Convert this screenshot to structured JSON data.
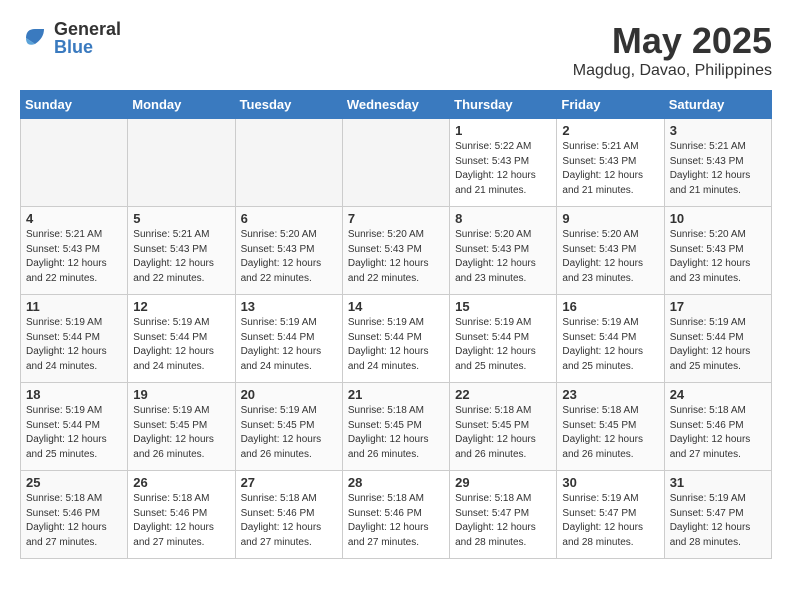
{
  "header": {
    "logo_general": "General",
    "logo_blue": "Blue",
    "month": "May 2025",
    "location": "Magdug, Davao, Philippines"
  },
  "days_of_week": [
    "Sunday",
    "Monday",
    "Tuesday",
    "Wednesday",
    "Thursday",
    "Friday",
    "Saturday"
  ],
  "weeks": [
    [
      {
        "day": "",
        "info": "",
        "empty": true
      },
      {
        "day": "",
        "info": "",
        "empty": true
      },
      {
        "day": "",
        "info": "",
        "empty": true
      },
      {
        "day": "",
        "info": "",
        "empty": true
      },
      {
        "day": "1",
        "info": "Sunrise: 5:22 AM\nSunset: 5:43 PM\nDaylight: 12 hours\nand 21 minutes.",
        "empty": false
      },
      {
        "day": "2",
        "info": "Sunrise: 5:21 AM\nSunset: 5:43 PM\nDaylight: 12 hours\nand 21 minutes.",
        "empty": false
      },
      {
        "day": "3",
        "info": "Sunrise: 5:21 AM\nSunset: 5:43 PM\nDaylight: 12 hours\nand 21 minutes.",
        "empty": false
      }
    ],
    [
      {
        "day": "4",
        "info": "Sunrise: 5:21 AM\nSunset: 5:43 PM\nDaylight: 12 hours\nand 22 minutes.",
        "empty": false
      },
      {
        "day": "5",
        "info": "Sunrise: 5:21 AM\nSunset: 5:43 PM\nDaylight: 12 hours\nand 22 minutes.",
        "empty": false
      },
      {
        "day": "6",
        "info": "Sunrise: 5:20 AM\nSunset: 5:43 PM\nDaylight: 12 hours\nand 22 minutes.",
        "empty": false
      },
      {
        "day": "7",
        "info": "Sunrise: 5:20 AM\nSunset: 5:43 PM\nDaylight: 12 hours\nand 22 minutes.",
        "empty": false
      },
      {
        "day": "8",
        "info": "Sunrise: 5:20 AM\nSunset: 5:43 PM\nDaylight: 12 hours\nand 23 minutes.",
        "empty": false
      },
      {
        "day": "9",
        "info": "Sunrise: 5:20 AM\nSunset: 5:43 PM\nDaylight: 12 hours\nand 23 minutes.",
        "empty": false
      },
      {
        "day": "10",
        "info": "Sunrise: 5:20 AM\nSunset: 5:43 PM\nDaylight: 12 hours\nand 23 minutes.",
        "empty": false
      }
    ],
    [
      {
        "day": "11",
        "info": "Sunrise: 5:19 AM\nSunset: 5:44 PM\nDaylight: 12 hours\nand 24 minutes.",
        "empty": false
      },
      {
        "day": "12",
        "info": "Sunrise: 5:19 AM\nSunset: 5:44 PM\nDaylight: 12 hours\nand 24 minutes.",
        "empty": false
      },
      {
        "day": "13",
        "info": "Sunrise: 5:19 AM\nSunset: 5:44 PM\nDaylight: 12 hours\nand 24 minutes.",
        "empty": false
      },
      {
        "day": "14",
        "info": "Sunrise: 5:19 AM\nSunset: 5:44 PM\nDaylight: 12 hours\nand 24 minutes.",
        "empty": false
      },
      {
        "day": "15",
        "info": "Sunrise: 5:19 AM\nSunset: 5:44 PM\nDaylight: 12 hours\nand 25 minutes.",
        "empty": false
      },
      {
        "day": "16",
        "info": "Sunrise: 5:19 AM\nSunset: 5:44 PM\nDaylight: 12 hours\nand 25 minutes.",
        "empty": false
      },
      {
        "day": "17",
        "info": "Sunrise: 5:19 AM\nSunset: 5:44 PM\nDaylight: 12 hours\nand 25 minutes.",
        "empty": false
      }
    ],
    [
      {
        "day": "18",
        "info": "Sunrise: 5:19 AM\nSunset: 5:44 PM\nDaylight: 12 hours\nand 25 minutes.",
        "empty": false
      },
      {
        "day": "19",
        "info": "Sunrise: 5:19 AM\nSunset: 5:45 PM\nDaylight: 12 hours\nand 26 minutes.",
        "empty": false
      },
      {
        "day": "20",
        "info": "Sunrise: 5:19 AM\nSunset: 5:45 PM\nDaylight: 12 hours\nand 26 minutes.",
        "empty": false
      },
      {
        "day": "21",
        "info": "Sunrise: 5:18 AM\nSunset: 5:45 PM\nDaylight: 12 hours\nand 26 minutes.",
        "empty": false
      },
      {
        "day": "22",
        "info": "Sunrise: 5:18 AM\nSunset: 5:45 PM\nDaylight: 12 hours\nand 26 minutes.",
        "empty": false
      },
      {
        "day": "23",
        "info": "Sunrise: 5:18 AM\nSunset: 5:45 PM\nDaylight: 12 hours\nand 26 minutes.",
        "empty": false
      },
      {
        "day": "24",
        "info": "Sunrise: 5:18 AM\nSunset: 5:46 PM\nDaylight: 12 hours\nand 27 minutes.",
        "empty": false
      }
    ],
    [
      {
        "day": "25",
        "info": "Sunrise: 5:18 AM\nSunset: 5:46 PM\nDaylight: 12 hours\nand 27 minutes.",
        "empty": false
      },
      {
        "day": "26",
        "info": "Sunrise: 5:18 AM\nSunset: 5:46 PM\nDaylight: 12 hours\nand 27 minutes.",
        "empty": false
      },
      {
        "day": "27",
        "info": "Sunrise: 5:18 AM\nSunset: 5:46 PM\nDaylight: 12 hours\nand 27 minutes.",
        "empty": false
      },
      {
        "day": "28",
        "info": "Sunrise: 5:18 AM\nSunset: 5:46 PM\nDaylight: 12 hours\nand 27 minutes.",
        "empty": false
      },
      {
        "day": "29",
        "info": "Sunrise: 5:18 AM\nSunset: 5:47 PM\nDaylight: 12 hours\nand 28 minutes.",
        "empty": false
      },
      {
        "day": "30",
        "info": "Sunrise: 5:19 AM\nSunset: 5:47 PM\nDaylight: 12 hours\nand 28 minutes.",
        "empty": false
      },
      {
        "day": "31",
        "info": "Sunrise: 5:19 AM\nSunset: 5:47 PM\nDaylight: 12 hours\nand 28 minutes.",
        "empty": false
      }
    ]
  ]
}
